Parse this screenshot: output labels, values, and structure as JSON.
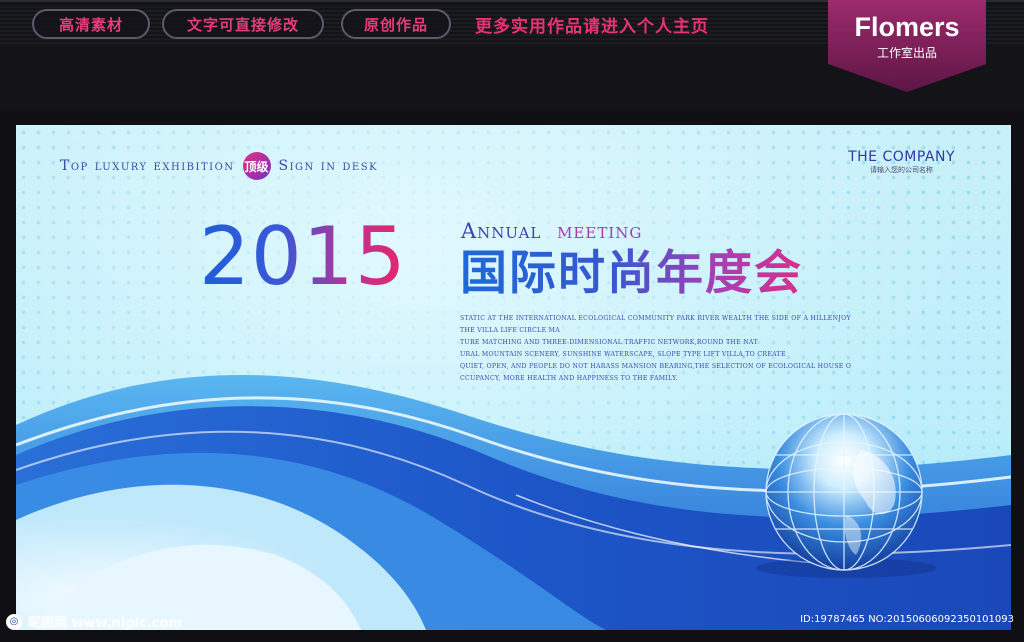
{
  "header": {
    "pills": [
      "高清素材",
      "文字可直接修改",
      "原创作品"
    ],
    "promo": "更多实用作品请进入个人主页",
    "brand_name": "Flomers",
    "brand_sub": "工作室出品"
  },
  "banner": {
    "tagline_a": "Top luxury exhibition",
    "badge": "顶级",
    "tagline_b": "Sign in desk",
    "company_name": "THE COMPANY",
    "company_sub": "请输入您的公司名称",
    "year": "2015",
    "annual": "Annual",
    "meeting": "meeting",
    "title_cn": "国际时尚年度会",
    "description": [
      "STATIC AT THE INTERNATIONAL ECOLOGICAL COMMUNITY PARK RIVER WEALTH THE SIDE OF A HILLENJOY",
      "THE VILLA LIFE CIRCLE MA",
      "TURE MATCHING AND THREE-DIMENSIONAL TRAFFIC NETWORK,ROUND THE NAT",
      "URAL MOUNTAIN SCENERY, SUNSHINE WATERSCAPE, SLOPE TYPE LIFT VILLA,TO CREATE",
      "QUIET, OPEN, AND PEOPLE DO NOT HARASS MANSION BEARING,THE SELECTION OF ECOLOGICAL HOUSE O",
      "CCUPANCY, MORE HEALTH AND HAPPINESS TO THE FAMILY."
    ]
  },
  "watermark": {
    "site": "昵图网 www.nipic.com",
    "id": "ID:19787465 NO:20150606092350101093"
  },
  "colors": {
    "accent_pink": "#e63c7c",
    "brand_purple": "#8e1f5e",
    "title_blue": "#1e5fd8",
    "wave_blue": "#1f5fd0"
  },
  "icons": [
    "globe-icon",
    "brand-ribbon-icon",
    "nipic-logo-icon"
  ]
}
